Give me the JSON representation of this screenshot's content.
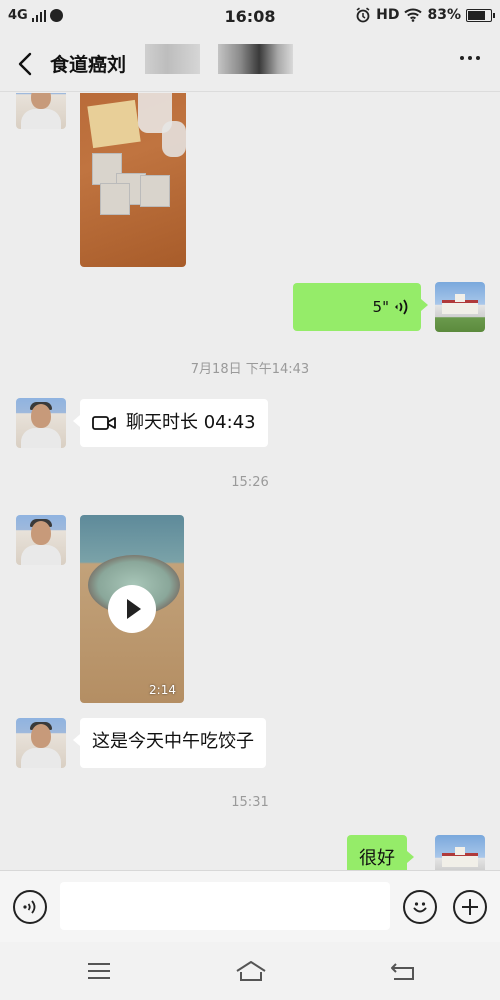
{
  "status_bar": {
    "network": "4G",
    "time": "16:08",
    "hd": "HD",
    "battery": "83%",
    "battery_level": 0.83
  },
  "header": {
    "title_visible": "食道癌刘",
    "title_tail": "",
    "more_icon": "more-icon"
  },
  "messages": {
    "voice": {
      "duration": "5\""
    },
    "time1": "7月18日 下午14:43",
    "call": {
      "text": "聊天时长 04:43"
    },
    "time2": "15:26",
    "video": {
      "duration": "2:14"
    },
    "text1": "这是今天中午吃饺子",
    "time3": "15:31",
    "reply": "很好"
  },
  "input": {
    "placeholder": ""
  },
  "colors": {
    "bubble_right": "#95ec69",
    "bubble_left": "#ffffff",
    "background": "#ededed"
  }
}
